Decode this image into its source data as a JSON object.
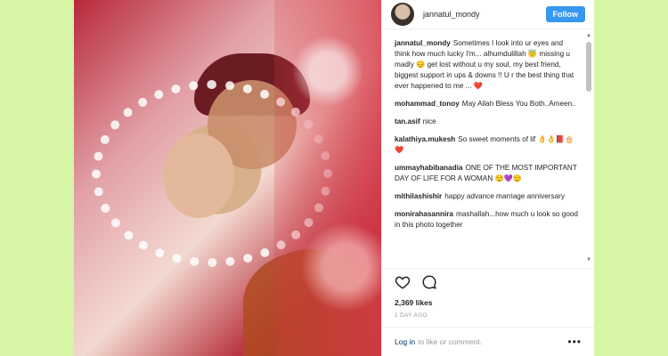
{
  "header": {
    "username": "jannatul_mondy",
    "follow_label": "Follow"
  },
  "comments": [
    {
      "user": "jannatul_mondy",
      "text": "Sometimes I look into ur eyes and think how much lucky I'm... alhumdulillah 😇 missing u madly 😔 get lost without u my soul, my best friend, biggest support in ups & downs !! U r the best thing that ever happened to me ... ❤️"
    },
    {
      "user": "mohammad_tonoy",
      "text": "May Allah Bless You Both..Ameen.."
    },
    {
      "user": "tan.asif",
      "text": "nice"
    },
    {
      "user": "kalathiya.mukesh",
      "text": "So sweet moments of lif 👌👌📕🎂❤️"
    },
    {
      "user": "ummayhabibanadia",
      "text": "ONE OF THE MOST IMPORTANT DAY OF LIFE FOR A WOMAN 😌💜😌"
    },
    {
      "user": "mithilashishir",
      "text": "happy advance marriage anniversary"
    },
    {
      "user": "monirahasannira",
      "text": "mashallah...how much u look so good in this photo together"
    }
  ],
  "likes": "2,369 likes",
  "time": "1 DAY AGO",
  "footer": {
    "login_label": "Log in",
    "suffix": "to like or comment.",
    "more_label": "•••"
  }
}
